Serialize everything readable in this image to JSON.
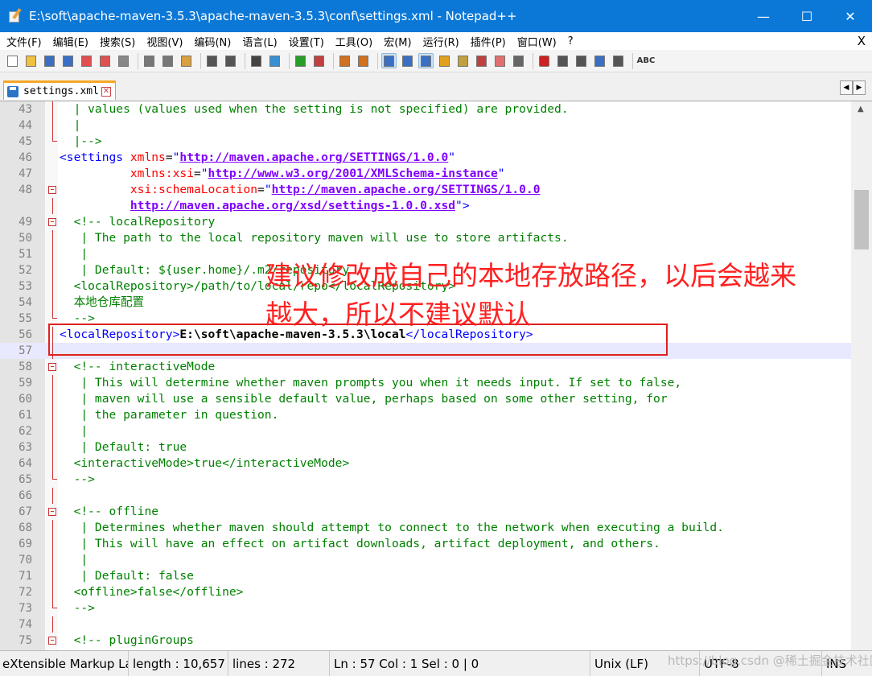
{
  "window": {
    "title": "E:\\soft\\apache-maven-3.5.3\\apache-maven-3.5.3\\conf\\settings.xml - Notepad++",
    "minimize_glyph": "—",
    "maximize_glyph": "☐",
    "close_glyph": "✕"
  },
  "menu": {
    "items": [
      "文件(F)",
      "编辑(E)",
      "搜索(S)",
      "视图(V)",
      "编码(N)",
      "语言(L)",
      "设置(T)",
      "工具(O)",
      "宏(M)",
      "运行(R)",
      "插件(P)",
      "窗口(W)",
      "?"
    ],
    "close_doc": "X"
  },
  "toolbar": {
    "icons": [
      "new-file-icon",
      "open-file-icon",
      "save-icon",
      "save-all-icon",
      "close-icon",
      "close-all-icon",
      "print-icon",
      "cut-icon",
      "copy-icon",
      "paste-icon",
      "undo-icon",
      "redo-icon",
      "find-icon",
      "replace-icon",
      "zoom-in-icon",
      "zoom-out-icon",
      "sync-v-icon",
      "sync-h-icon",
      "wrap-icon",
      "all-chars-icon",
      "indent-guide-icon",
      "udl-icon",
      "doc-map-icon",
      "function-list-icon",
      "folder-workspace-icon",
      "monitor-icon",
      "record-macro-icon",
      "stop-macro-icon",
      "play-macro-icon",
      "run-macro-multiple-icon",
      "save-macro-icon",
      "spellcheck-icon"
    ],
    "spellcheck_label": "ABC"
  },
  "tab": {
    "label": "settings.xml",
    "close_glyph": "✕",
    "left_arrow": "◀",
    "right_arrow": "▶"
  },
  "editor": {
    "lines": [
      {
        "n": "43",
        "fold": "line",
        "html": "  <span class='c'>| values (values used when the setting is not specified) are provided.</span>"
      },
      {
        "n": "44",
        "fold": "line",
        "html": "  <span class='c'>|</span>"
      },
      {
        "n": "45",
        "fold": "end",
        "html": "  <span class='c'>|--></span>"
      },
      {
        "n": "46",
        "fold": "none",
        "html": "<span class='t'>&lt;settings</span> <span class='a'>xmlns</span><span class='p'>=</span><span class='t'>\"</span><span class='v'>http://maven.apache.org/SETTINGS/1.0.0</span><span class='t'>\"</span>"
      },
      {
        "n": "47",
        "fold": "none",
        "html": "          <span class='a'>xmlns:xsi</span><span class='p'>=</span><span class='t'>\"</span><span class='v'>http://www.w3.org/2001/XMLSchema-instance</span><span class='t'>\"</span>"
      },
      {
        "n": "48",
        "fold": "box",
        "html": "          <span class='a'>xsi:schemaLocation</span><span class='p'>=</span><span class='t'>\"</span><span class='v'>http://maven.apache.org/SETTINGS/1.0.0</span>"
      },
      {
        "n": "",
        "fold": "line",
        "html": "          <span class='v'>http://maven.apache.org/xsd/settings-1.0.0.xsd</span><span class='t'>\"&gt;</span>"
      },
      {
        "n": "49",
        "fold": "box",
        "html": "  <span class='c'>&lt;!-- localRepository</span>"
      },
      {
        "n": "50",
        "fold": "line",
        "html": "   <span class='c'>| The path to the local repository maven will use to store artifacts.</span>"
      },
      {
        "n": "51",
        "fold": "line",
        "html": "   <span class='c'>|</span>"
      },
      {
        "n": "52",
        "fold": "line",
        "html": "   <span class='c'>| Default: ${user.home}/.m2/repository</span>"
      },
      {
        "n": "53",
        "fold": "line",
        "html": "  <span class='c'>&lt;localRepository&gt;/path/to/local/repo&lt;/localRepository&gt;</span>"
      },
      {
        "n": "54",
        "fold": "line",
        "html": "  <span class='c'>本地仓库配置</span>"
      },
      {
        "n": "55",
        "fold": "end",
        "html": "  <span class='c'>--&gt;</span>"
      },
      {
        "n": "56",
        "fold": "line",
        "html": "<span class='t'>&lt;localRepository&gt;</span><span class='k'>E:\\soft\\apache-maven-3.5.3\\local</span><span class='t'>&lt;/localRepository&gt;</span>"
      },
      {
        "n": "57",
        "fold": "line",
        "current": true,
        "html": ""
      },
      {
        "n": "58",
        "fold": "box",
        "html": "  <span class='c'>&lt;!-- interactiveMode</span>"
      },
      {
        "n": "59",
        "fold": "line",
        "html": "   <span class='c'>| This will determine whether maven prompts you when it needs input. If set to false,</span>"
      },
      {
        "n": "60",
        "fold": "line",
        "html": "   <span class='c'>| maven will use a sensible default value, perhaps based on some other setting, for</span>"
      },
      {
        "n": "61",
        "fold": "line",
        "html": "   <span class='c'>| the parameter in question.</span>"
      },
      {
        "n": "62",
        "fold": "line",
        "html": "   <span class='c'>|</span>"
      },
      {
        "n": "63",
        "fold": "line",
        "html": "   <span class='c'>| Default: true</span>"
      },
      {
        "n": "64",
        "fold": "line",
        "html": "  <span class='c'>&lt;interactiveMode&gt;true&lt;/interactiveMode&gt;</span>"
      },
      {
        "n": "65",
        "fold": "end",
        "html": "  <span class='c'>--&gt;</span>"
      },
      {
        "n": "66",
        "fold": "line",
        "html": ""
      },
      {
        "n": "67",
        "fold": "box",
        "html": "  <span class='c'>&lt;!-- offline</span>"
      },
      {
        "n": "68",
        "fold": "line",
        "html": "   <span class='c'>| Determines whether maven should attempt to connect to the network when executing a build.</span>"
      },
      {
        "n": "69",
        "fold": "line",
        "html": "   <span class='c'>| This will have an effect on artifact downloads, artifact deployment, and others.</span>"
      },
      {
        "n": "70",
        "fold": "line",
        "html": "   <span class='c'>|</span>"
      },
      {
        "n": "71",
        "fold": "line",
        "html": "   <span class='c'>| Default: false</span>"
      },
      {
        "n": "72",
        "fold": "line",
        "html": "  <span class='c'>&lt;offline&gt;false&lt;/offline&gt;</span>"
      },
      {
        "n": "73",
        "fold": "end",
        "html": "  <span class='c'>--&gt;</span>"
      },
      {
        "n": "74",
        "fold": "line",
        "html": ""
      },
      {
        "n": "75",
        "fold": "box",
        "html": "  <span class='c'>&lt;!-- pluginGroups</span>"
      }
    ]
  },
  "annotation": {
    "line1": "建议修改成自己的本地存放路径，以后会越来",
    "line2": "越大，所以不建议默认"
  },
  "status": {
    "lang": "eXtensible Markup La",
    "length": "length : 10,657",
    "lines": "lines : 272",
    "pos": "Ln : 57    Col : 1    Sel : 0 | 0",
    "eol": "Unix (LF)",
    "encoding": "UTF-8",
    "mode": "INS",
    "watermark": "https://blog.csdn @稀土掘金技术社区"
  }
}
